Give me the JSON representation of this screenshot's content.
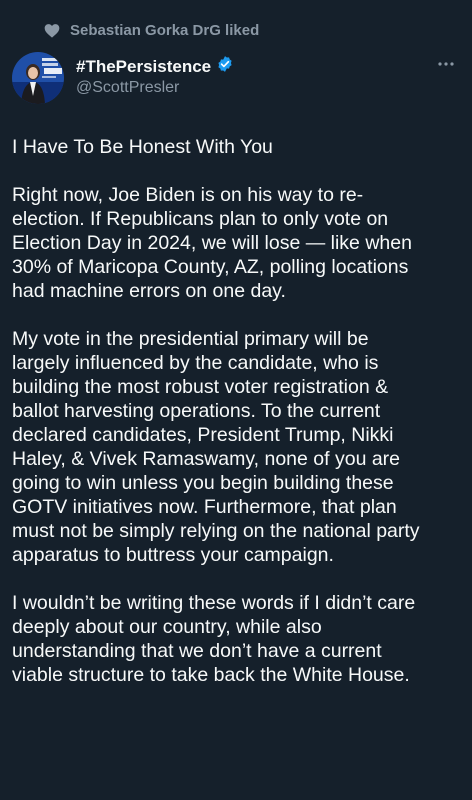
{
  "social_context": {
    "text": "Sebastian Gorka DrG liked",
    "icon": "heart-icon"
  },
  "author": {
    "display_name": "#ThePersistence",
    "handle": "@ScottPresler",
    "verified_icon": "verified-badge-icon"
  },
  "colors": {
    "background": "#15202b",
    "primary_text": "#f7f9f9",
    "secondary_text": "#8b98a5",
    "verified": "#1d9bf0"
  },
  "tweet": {
    "paragraphs": [
      "I Have To Be Honest With You",
      "Right now, Joe Biden is on his way to re-\nelection. If Republicans plan to only vote on\nElection Day in 2024, we will lose — like when\n30% of Maricopa County, AZ, polling locations\nhad machine errors on one day.",
      "My vote in the presidential primary will be\nlargely influenced by the candidate, who is\nbuilding the most robust voter registration &\nballot harvesting operations. To the current\ndeclared candidates, President Trump, Nikki\nHaley, & Vivek Ramaswamy, none of you are\ngoing to win unless you begin building these\nGOTV initiatives now. Furthermore, that plan\nmust not be simply relying on the national party\napparatus to buttress your campaign.",
      "I wouldn’t be writing these words if I didn’t care\ndeeply about our country, while also\nunderstanding that we don’t have a current\nviable structure to take back the White House."
    ]
  }
}
